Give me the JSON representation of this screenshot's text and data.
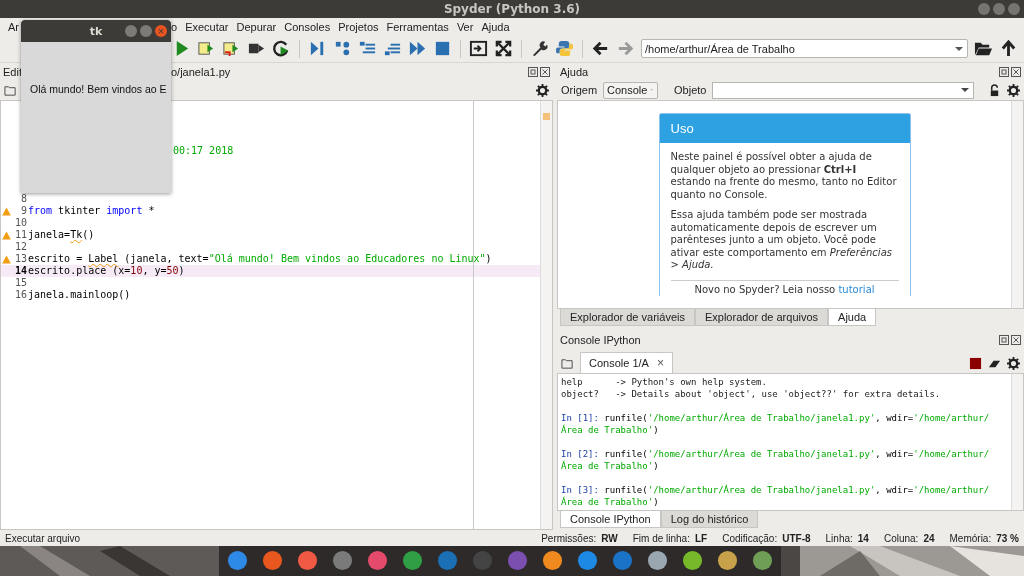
{
  "window": {
    "title": "Spyder (Python 3.6)"
  },
  "menu": [
    "Ar",
    "o",
    "Executar",
    "Depurar",
    "Consoles",
    "Projetos",
    "Ferramentas",
    "Ver",
    "Ajuda"
  ],
  "path_field": {
    "value": "/home/arthur/Área de Trabalho"
  },
  "editor": {
    "pane_title": "Edit",
    "file_path": "o/janela1.py",
    "partial_line": "00:17 2018",
    "lines": [
      {
        "number": "8",
        "warning": false,
        "current": false
      },
      {
        "number": "9",
        "warning": true,
        "current": false,
        "tokens": [
          {
            "kind": "keyword",
            "text": "from"
          },
          {
            "kind": "plain",
            "text": " tkinter "
          },
          {
            "kind": "keyword",
            "text": "import"
          },
          {
            "kind": "plain",
            "text": " *"
          }
        ]
      },
      {
        "number": "10",
        "warning": false,
        "current": false
      },
      {
        "number": "11",
        "warning": true,
        "current": false,
        "tokens": [
          {
            "kind": "plain",
            "text": "janela="
          },
          {
            "kind": "flagged",
            "text": "Tk"
          },
          {
            "kind": "plain",
            "text": "()"
          }
        ]
      },
      {
        "number": "12",
        "warning": false,
        "current": false
      },
      {
        "number": "13",
        "warning": true,
        "current": false,
        "tokens": [
          {
            "kind": "plain",
            "text": "escrito = "
          },
          {
            "kind": "flagged",
            "text": "Label"
          },
          {
            "kind": "plain",
            "text": " (janela, text="
          },
          {
            "kind": "string",
            "text": "\"Olá mundo! Bem vindos ao Educadores no Linux\""
          },
          {
            "kind": "plain",
            "text": ")"
          }
        ]
      },
      {
        "number": "14",
        "warning": false,
        "current": true,
        "tokens": [
          {
            "kind": "plain",
            "text": "escrito.place (x="
          },
          {
            "kind": "number",
            "text": "10"
          },
          {
            "kind": "plain",
            "text": ", y="
          },
          {
            "kind": "number",
            "text": "50"
          },
          {
            "kind": "plain",
            "text": ")"
          }
        ]
      },
      {
        "number": "15",
        "warning": false,
        "current": false
      },
      {
        "number": "16",
        "warning": false,
        "current": false,
        "tokens": [
          {
            "kind": "plain",
            "text": "janela.mainloop()"
          }
        ]
      }
    ]
  },
  "help": {
    "pane_title": "Ajuda",
    "source_label": "Origem",
    "source_value": "Console",
    "object_label": "Objeto",
    "card": {
      "title": "Uso",
      "paragraphs": [
        "Neste painel é possível obter a ajuda de qualquer objeto ao pressionar **Ctrl+I** estando na frente do mesmo, tanto no Editor quanto no Console.",
        "Essa ajuda também pode ser mostrada automaticamente depois de escrever um parênteses junto a um objeto. Você pode ativar este comportamento em *Preferências > Ajuda.*"
      ],
      "footer": "Novo no Spyder? Leia nosso",
      "footer_link": "tutorial"
    },
    "tabs": [
      {
        "label": "Explorador de variáveis",
        "selected": false
      },
      {
        "label": "Explorador de arquivos",
        "selected": false
      },
      {
        "label": "Ajuda",
        "selected": true
      }
    ]
  },
  "console": {
    "pane_title": "Console IPython",
    "tab": "Console 1/A",
    "close": "×",
    "lines": [
      {
        "kind": "output",
        "text": "help      -> Python's own help system."
      },
      {
        "kind": "output",
        "text": "object?   -> Details about 'object', use 'object??' for extra details."
      },
      {
        "kind": "input",
        "prompt": "In [1]:",
        "tokens": [
          {
            "kind": "plain",
            "text": " runfile("
          },
          {
            "kind": "string",
            "text": "'/home/arthur/Área de Trabalho/janela1.py'"
          },
          {
            "kind": "plain",
            "text": ", wdir="
          },
          {
            "kind": "string",
            "text": "'/home/arthur/"
          }
        ]
      },
      {
        "kind": "continuation",
        "tokens": [
          {
            "kind": "string",
            "text": "Área de Trabalho'"
          },
          {
            "kind": "plain",
            "text": ")"
          }
        ]
      },
      {
        "kind": "input",
        "prompt": "In [2]:",
        "tokens": [
          {
            "kind": "plain",
            "text": " runfile("
          },
          {
            "kind": "string",
            "text": "'/home/arthur/Área de Trabalho/janela1.py'"
          },
          {
            "kind": "plain",
            "text": ", wdir="
          },
          {
            "kind": "string",
            "text": "'/home/arthur/"
          }
        ]
      },
      {
        "kind": "continuation",
        "tokens": [
          {
            "kind": "string",
            "text": "Área de Trabalho'"
          },
          {
            "kind": "plain",
            "text": ")"
          }
        ]
      },
      {
        "kind": "input",
        "prompt": "In [3]:",
        "tokens": [
          {
            "kind": "plain",
            "text": " runfile("
          },
          {
            "kind": "string",
            "text": "'/home/arthur/Área de Trabalho/janela1.py'"
          },
          {
            "kind": "plain",
            "text": ", wdir="
          },
          {
            "kind": "string",
            "text": "'/home/arthur/"
          }
        ]
      },
      {
        "kind": "continuation",
        "tokens": [
          {
            "kind": "string",
            "text": "Área de Trabalho'"
          },
          {
            "kind": "plain",
            "text": ")"
          }
        ]
      }
    ],
    "tabs": [
      {
        "label": "Console IPython",
        "selected": true
      },
      {
        "label": "Log do histórico",
        "selected": false
      }
    ]
  },
  "status_bar": {
    "message": "Executar arquivo",
    "fields": [
      {
        "label": "Permissões:",
        "value": "RW"
      },
      {
        "label": "Fim de linha:",
        "value": "LF"
      },
      {
        "label": "Codificação:",
        "value": "UTF-8"
      },
      {
        "label": "Linha:",
        "value": "14"
      },
      {
        "label": "Coluna:",
        "value": "24"
      },
      {
        "label": "Memória:",
        "value": "73 %"
      }
    ]
  },
  "tk_window": {
    "title": "tk",
    "close": "×",
    "label": "Olá mundo! Bem vindos ao E"
  }
}
